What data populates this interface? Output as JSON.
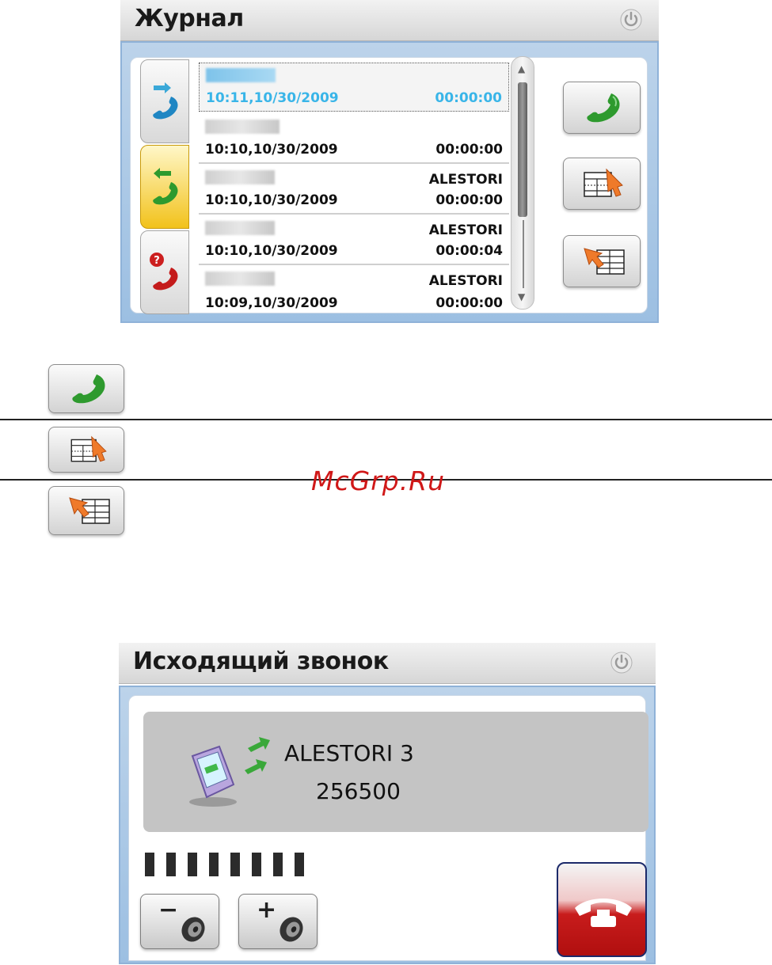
{
  "journal": {
    "title": "Журнал",
    "tabs": [
      {
        "name": "outgoing-calls-tab",
        "icon": "outgoing-call-icon",
        "active": false
      },
      {
        "name": "incoming-calls-tab",
        "icon": "incoming-call-icon",
        "active": true
      },
      {
        "name": "missed-calls-tab",
        "icon": "missed-call-icon",
        "active": false
      }
    ],
    "calls": [
      {
        "name": "",
        "time": "10:11,10/30/2009",
        "duration": "00:00:00",
        "selected": true
      },
      {
        "name": "",
        "time": "10:10,10/30/2009",
        "duration": "00:00:00",
        "selected": false
      },
      {
        "name": "ALESTORI",
        "time": "10:10,10/30/2009",
        "duration": "00:00:00",
        "selected": false
      },
      {
        "name": "ALESTORI",
        "time": "10:10,10/30/2009",
        "duration": "00:00:04",
        "selected": false
      },
      {
        "name": "ALESTORI",
        "time": "10:09,10/30/2009",
        "duration": "00:00:00",
        "selected": false
      }
    ],
    "actions": [
      "call-icon",
      "save-to-contacts-icon",
      "delete-entry-icon"
    ]
  },
  "legend": {
    "items": [
      "call-icon",
      "save-to-contacts-icon",
      "delete-entry-icon"
    ]
  },
  "watermark": "McGrp.Ru",
  "outgoing": {
    "title": "Исходящий звонок",
    "caller_name": "ALESTORI 3",
    "caller_number": "256500",
    "volume_level": 8,
    "volume_bars": 8,
    "vol_down_sign": "−",
    "vol_up_sign": "+"
  },
  "colors": {
    "accent_blue": "#39b5e8",
    "call_green": "#2e9a2e",
    "hangup_red": "#c81c1c",
    "active_tab_yellow": "#f2c21b"
  }
}
